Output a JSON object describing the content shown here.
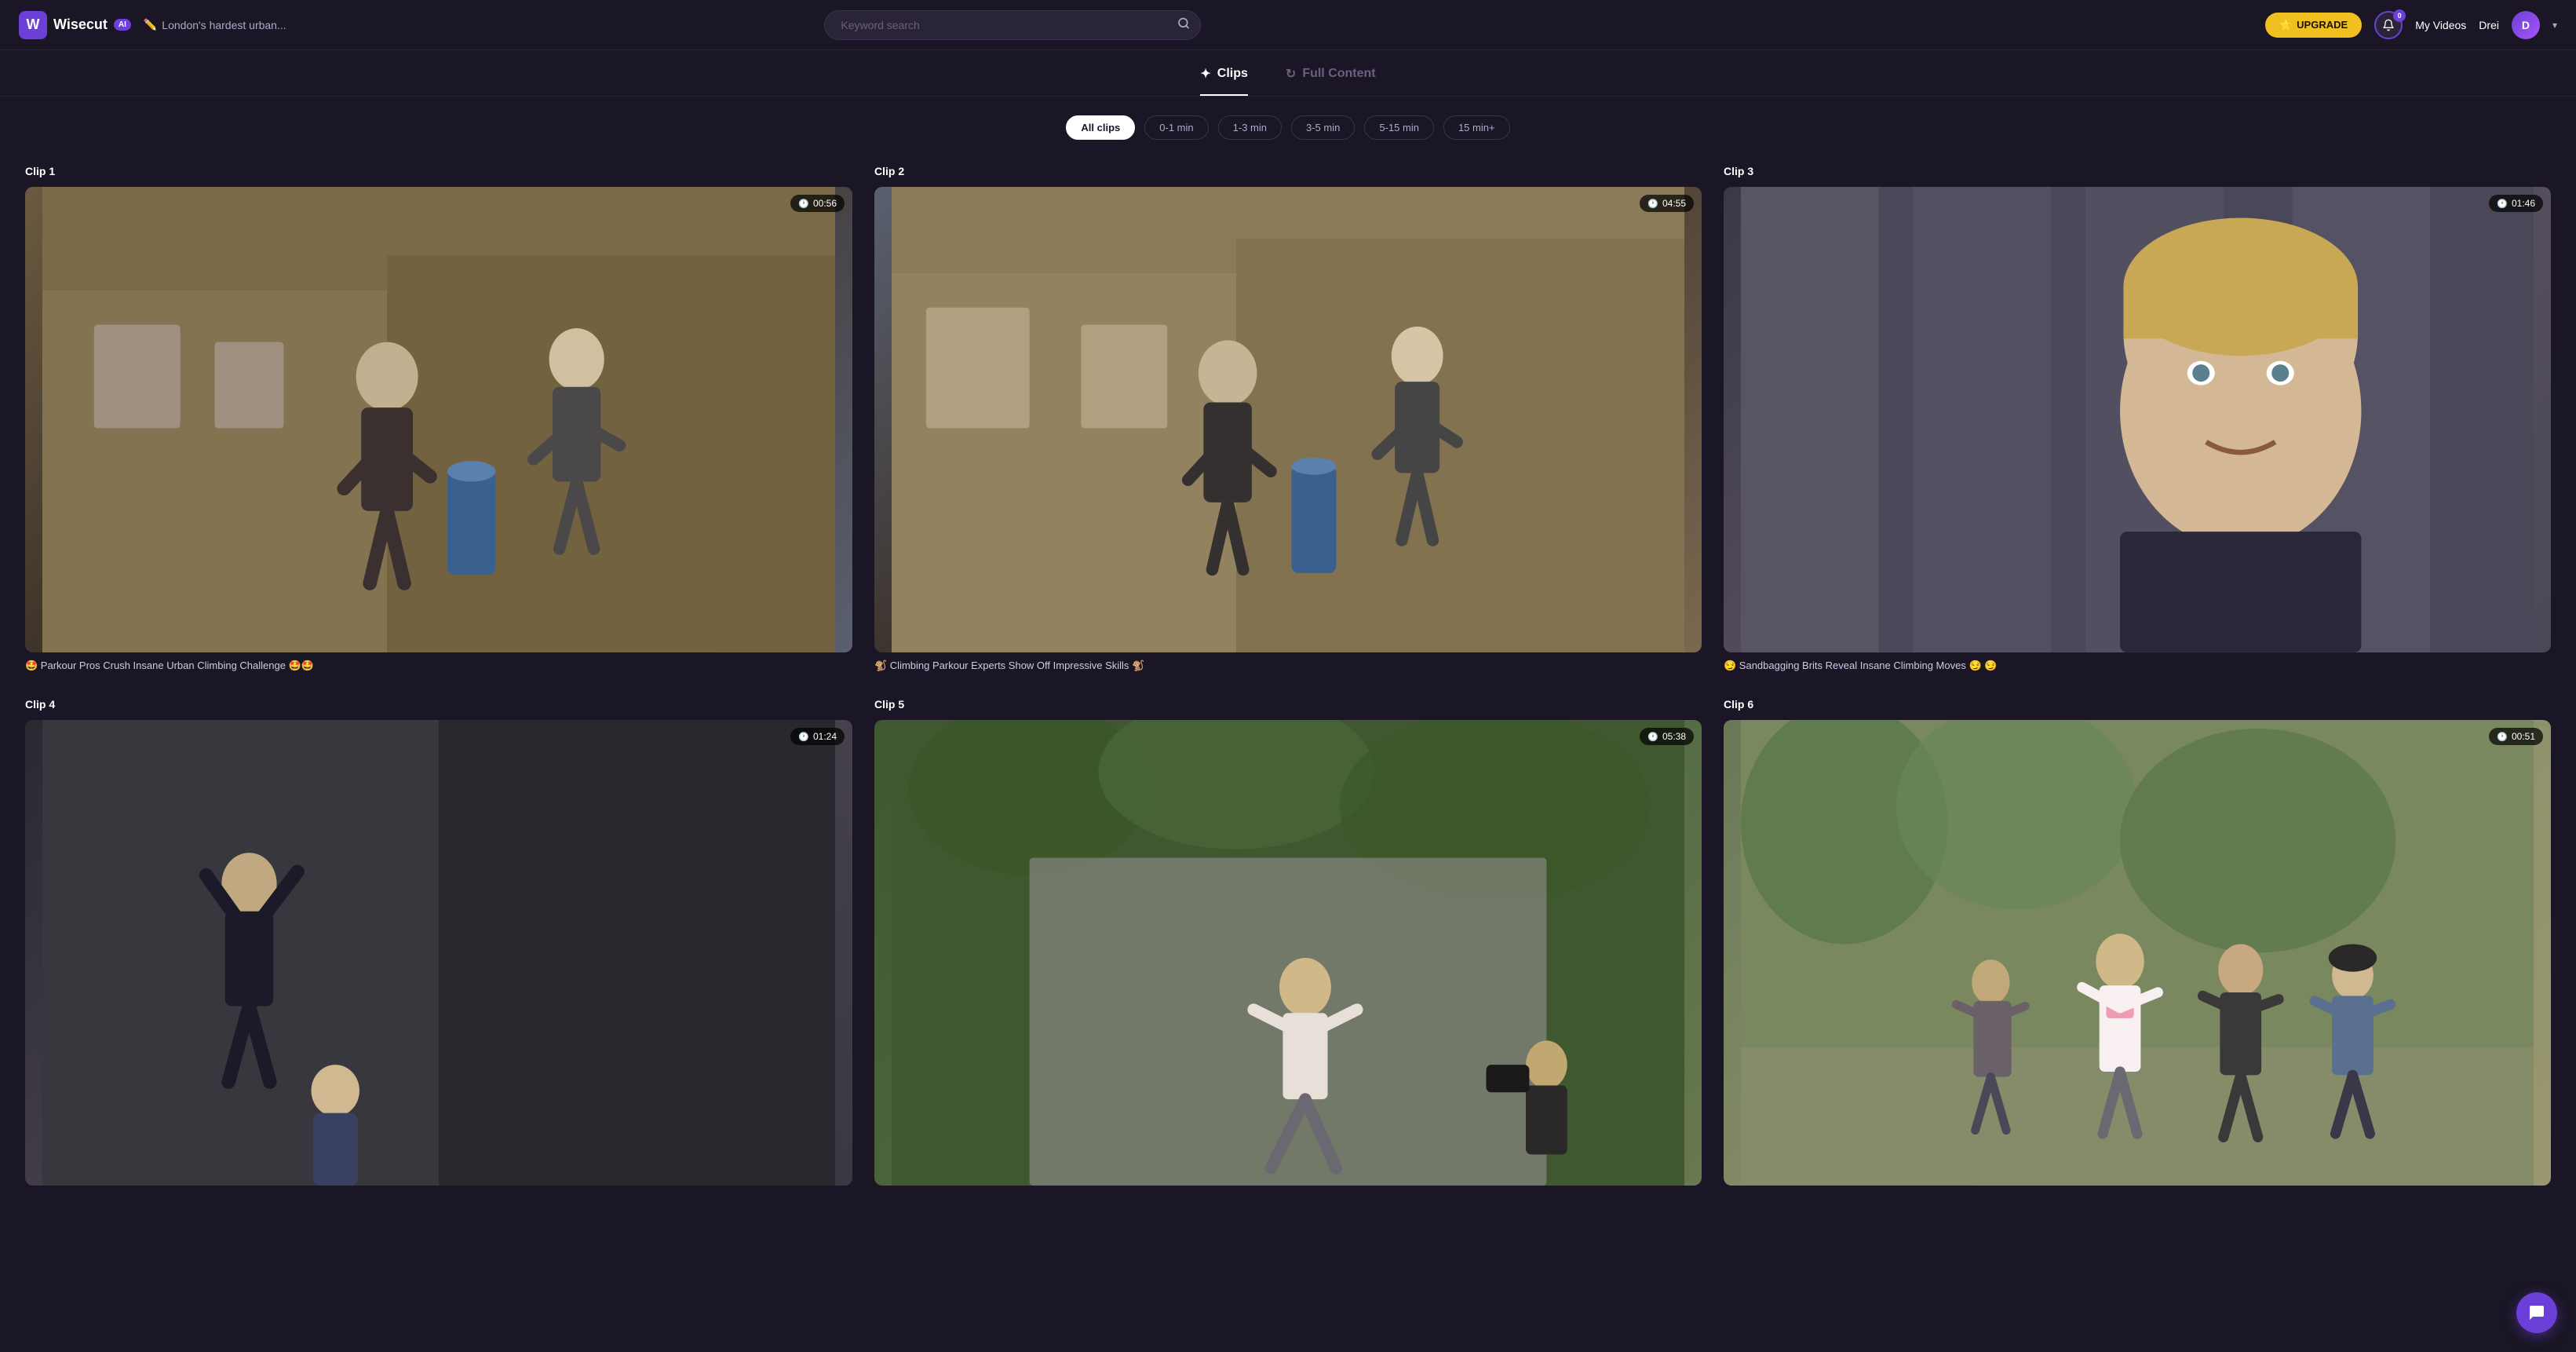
{
  "logo": {
    "icon_text": "W",
    "name": "Wisecut",
    "ai_label": "AI"
  },
  "project": {
    "title": "London's hardest urban..."
  },
  "search": {
    "placeholder": "Keyword search"
  },
  "header": {
    "upgrade_label": "UPGRADE",
    "upgrade_icon": "⭐",
    "notif_count": "0",
    "my_videos_label": "My Videos",
    "user_name": "Drei",
    "chevron": "▾"
  },
  "tabs": [
    {
      "id": "clips",
      "label": "Clips",
      "icon": "✦",
      "active": true
    },
    {
      "id": "full-content",
      "label": "Full Content",
      "icon": "↻",
      "active": false
    }
  ],
  "filters": [
    {
      "id": "all-clips",
      "label": "All clips",
      "active": true
    },
    {
      "id": "0-1min",
      "label": "0-1 min",
      "active": false
    },
    {
      "id": "1-3min",
      "label": "1-3 min",
      "active": false
    },
    {
      "id": "3-5min",
      "label": "3-5 min",
      "active": false
    },
    {
      "id": "5-15min",
      "label": "5-15 min",
      "active": false
    },
    {
      "id": "15min-plus",
      "label": "15 min+",
      "active": false
    }
  ],
  "clips": [
    {
      "id": 1,
      "label": "Clip 1",
      "duration": "00:56",
      "title": "🤩 Parkour Pros Crush Insane Urban Climbing Challenge 🤩🤩",
      "thumb_class": "thumb-1"
    },
    {
      "id": 2,
      "label": "Clip 2",
      "duration": "04:55",
      "title": "🐒 Climbing Parkour Experts Show Off Impressive Skills 🐒",
      "thumb_class": "thumb-2"
    },
    {
      "id": 3,
      "label": "Clip 3",
      "duration": "01:46",
      "title": "😏 Sandbagging Brits Reveal Insane Climbing Moves 😏 😏",
      "thumb_class": "thumb-3"
    },
    {
      "id": 4,
      "label": "Clip 4",
      "duration": "01:24",
      "title": "",
      "thumb_class": "thumb-4"
    },
    {
      "id": 5,
      "label": "Clip 5",
      "duration": "05:38",
      "title": "",
      "thumb_class": "thumb-5"
    },
    {
      "id": 6,
      "label": "Clip 6",
      "duration": "00:51",
      "title": "",
      "thumb_class": "thumb-6"
    }
  ],
  "colors": {
    "bg": "#1a1625",
    "accent": "#6c3fd8",
    "upgrade": "#f0c020"
  }
}
